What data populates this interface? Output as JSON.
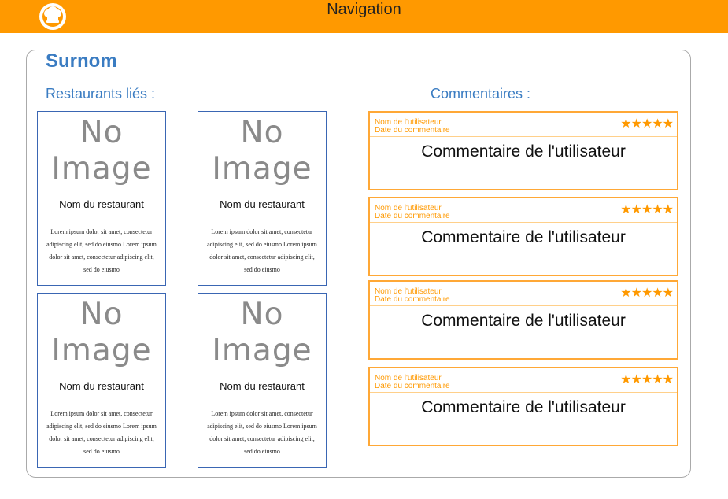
{
  "nav": {
    "title": "Navigation",
    "logo_icon": "chef-hat-logo-icon",
    "color": "#ff9900"
  },
  "profile": {
    "nickname": "Surnom"
  },
  "restaurants": {
    "title": "Restaurants liés :",
    "items": [
      {
        "image": "No Image",
        "name": "Nom du restaurant",
        "description": "Lorem ipsum dolor sit amet, consectetur adipiscing elit, sed do eiusmo Lorem ipsum dolor sit amet, consectetur adipiscing elit, sed do eiusmo"
      },
      {
        "image": "No Image",
        "name": "Nom du restaurant",
        "description": "Lorem ipsum dolor sit amet, consectetur adipiscing elit, sed do eiusmo Lorem ipsum dolor sit amet, consectetur adipiscing elit, sed do eiusmo"
      },
      {
        "image": "No Image",
        "name": "Nom du restaurant",
        "description": "Lorem ipsum dolor sit amet, consectetur adipiscing elit, sed do eiusmo Lorem ipsum dolor sit amet, consectetur adipiscing elit, sed do eiusmo"
      },
      {
        "image": "No Image",
        "name": "Nom du restaurant",
        "description": "Lorem ipsum dolor sit amet, consectetur adipiscing elit, sed do eiusmo Lorem ipsum dolor sit amet, consectetur adipiscing elit, sed do eiusmo"
      }
    ]
  },
  "comments": {
    "title": "Commentaires :",
    "items": [
      {
        "user": "Nom de l'utilisateur",
        "date": "Date du commentaire",
        "stars": "★★★★★",
        "rating": 5,
        "text": "Commentaire de l'utilisateur"
      },
      {
        "user": "Nom de l'utilisateur",
        "date": "Date du commentaire",
        "stars": "★★★★★",
        "rating": 5,
        "text": "Commentaire de l'utilisateur"
      },
      {
        "user": "Nom de l'utilisateur",
        "date": "Date du commentaire",
        "stars": "★★★★★",
        "rating": 5,
        "text": "Commentaire de l'utilisateur"
      },
      {
        "user": "Nom de l'utilisateur",
        "date": "Date du commentaire",
        "stars": "★★★★★",
        "rating": 5,
        "text": "Commentaire de l'utilisateur"
      }
    ]
  }
}
